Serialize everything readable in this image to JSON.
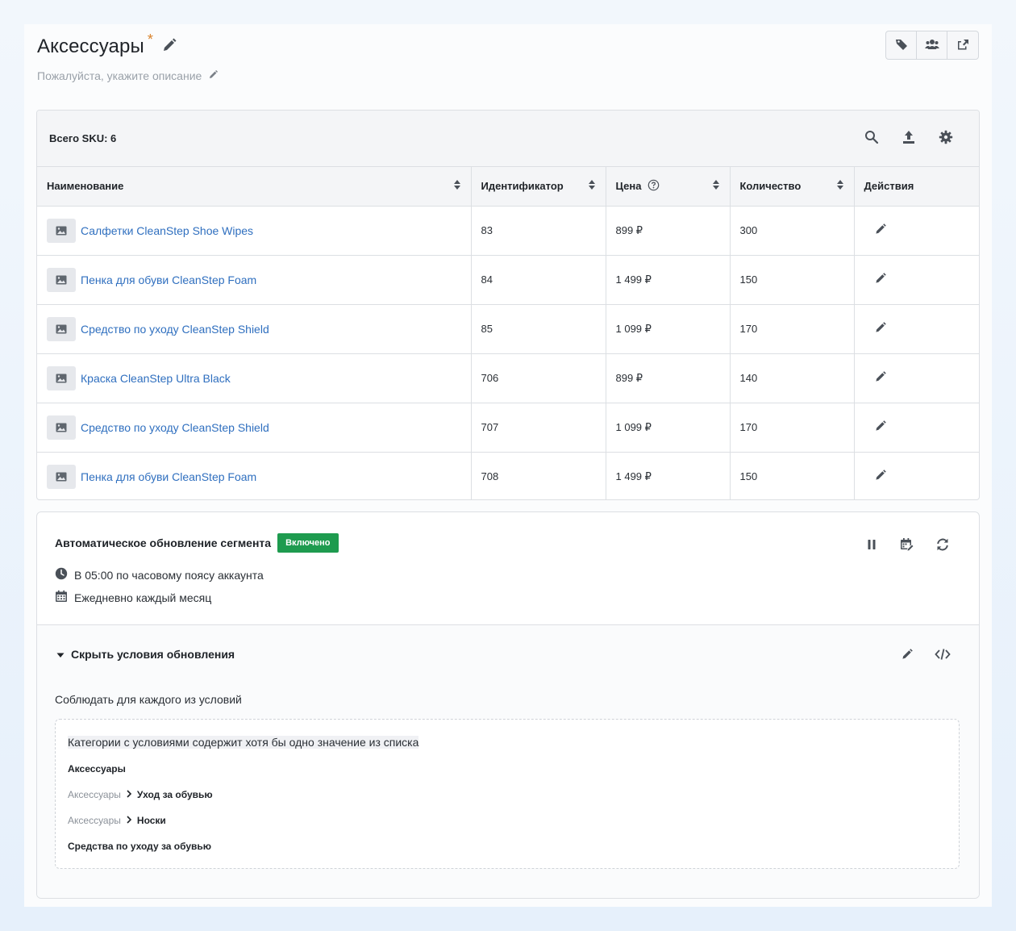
{
  "header": {
    "title": "Аксессуары",
    "required_mark": "*",
    "description_placeholder": "Пожалуйста, укажите описание",
    "actions": [
      "tag-icon",
      "users-icon",
      "share-icon"
    ]
  },
  "table": {
    "total_label": "Всего SKU: 6",
    "tools": [
      "search-icon",
      "upload-icon",
      "settings-icon"
    ],
    "columns": {
      "name": "Наименование",
      "id": "Идентификатор",
      "price": "Цена",
      "qty": "Количество",
      "actions": "Действия"
    },
    "rows": [
      {
        "name": "Салфетки CleanStep Shoe Wipes",
        "id": "83",
        "price": "899 ₽",
        "qty": "300"
      },
      {
        "name": "Пенка для обуви CleanStep Foam",
        "id": "84",
        "price": "1 499 ₽",
        "qty": "150"
      },
      {
        "name": "Средство по уходу CleanStep Shield",
        "id": "85",
        "price": "1 099 ₽",
        "qty": "170"
      },
      {
        "name": "Краска CleanStep Ultra Black",
        "id": "706",
        "price": "899 ₽",
        "qty": "140"
      },
      {
        "name": "Средство по уходу CleanStep Shield",
        "id": "707",
        "price": "1 099 ₽",
        "qty": "170"
      },
      {
        "name": "Пенка для обуви CleanStep Foam",
        "id": "708",
        "price": "1 499 ₽",
        "qty": "150"
      }
    ]
  },
  "update": {
    "title": "Автоматическое обновление сегмента",
    "status": "Включено",
    "status_color": "#1e9b4f",
    "time_line": "В 05:00 по часовому поясу аккаунта",
    "schedule_line": "Ежедневно каждый месяц",
    "toggle_label": "Скрыть условия обновления",
    "observe_label": "Соблюдать для каждого из условий",
    "condition_head": "Категории с условиями содержит хотя бы одно значение из списка",
    "items": {
      "root": "Аксессуары",
      "parent": "Аксессуары",
      "child_1": "Уход за обувью",
      "child_2": "Носки",
      "last": "Средства по уходу за обувью"
    }
  },
  "colors": {
    "link": "#2f6fbf",
    "accent_star": "#d9822b",
    "icon": "#4a5058"
  }
}
